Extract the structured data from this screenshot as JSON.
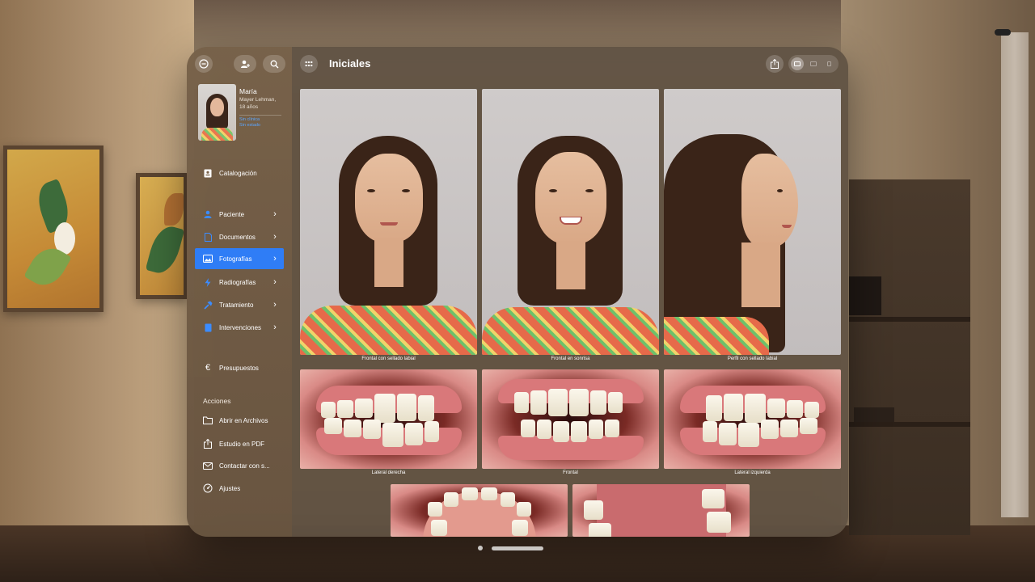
{
  "sidebar": {
    "top_buttons": [
      {
        "icon": "minus-circle-icon"
      },
      {
        "icon": "person-add-icon"
      },
      {
        "icon": "search-icon"
      }
    ],
    "patient": {
      "first_name": "María",
      "last_name_line": "Mayer Lehman,",
      "age": "18 años",
      "meta_line1": "Sin clínica",
      "meta_line2": "Sin estado"
    },
    "catalog": {
      "label": "Catalogación",
      "icon": "catalog-icon"
    },
    "nav_items": [
      {
        "label": "Paciente",
        "icon": "person-icon"
      },
      {
        "label": "Documentos",
        "icon": "document-icon"
      },
      {
        "label": "Fotografías",
        "icon": "photos-icon",
        "active": true
      },
      {
        "label": "Radiografías",
        "icon": "bolt-icon"
      },
      {
        "label": "Tratamiento",
        "icon": "hammer-icon"
      },
      {
        "label": "Intervenciones",
        "icon": "book-icon"
      }
    ],
    "budget": {
      "label": "Presupuestos",
      "icon": "euro-icon"
    },
    "actions_title": "Acciones",
    "actions": [
      {
        "label": "Abrir en Archivos",
        "icon": "folder-icon"
      },
      {
        "label": "Estudio en PDF",
        "icon": "share-icon"
      },
      {
        "label": "Contactar con s...",
        "icon": "envelope-icon"
      },
      {
        "label": "Ajustes",
        "icon": "gauge-icon"
      }
    ]
  },
  "header": {
    "title": "Iniciales"
  },
  "photos": {
    "row1": [
      {
        "caption": "Frontal con sellado labial"
      },
      {
        "caption": "Frontal en sonrisa"
      },
      {
        "caption": "Perfil con sellado labial"
      }
    ],
    "row2": [
      {
        "caption": "Lateral derecha"
      },
      {
        "caption": "Frontal"
      },
      {
        "caption": "Lateral izquierda"
      }
    ]
  },
  "colors": {
    "accent": "#2f7df6",
    "meta_text": "#5aa6ff"
  }
}
